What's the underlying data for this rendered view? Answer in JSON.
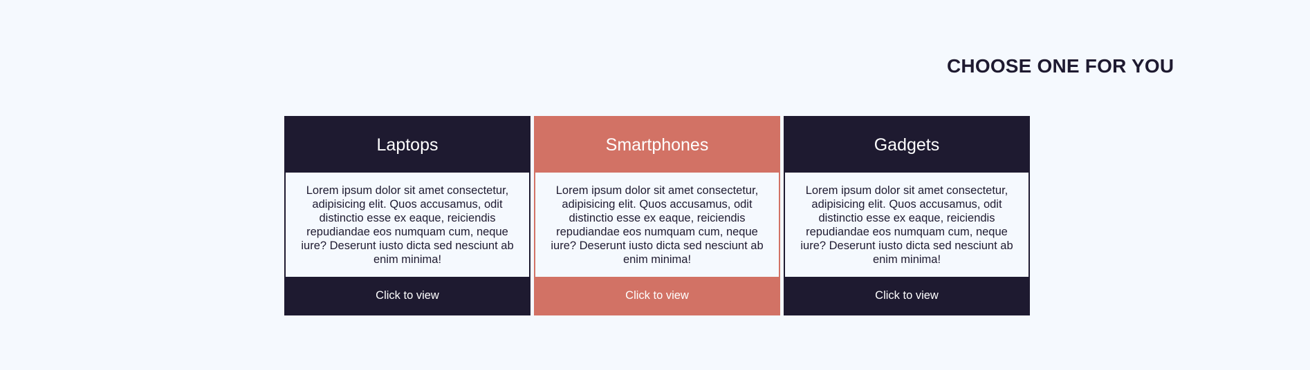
{
  "section": {
    "title": "CHOOSE ONE FOR YOU"
  },
  "colors": {
    "background": "#f5f9fe",
    "dark": "#1e1a30",
    "accent": "#d27265",
    "text_light": "#ffffff"
  },
  "cards": [
    {
      "title": "Laptops",
      "body": "Lorem ipsum dolor sit amet consectetur, adipisicing elit. Quos accusamus, odit distinctio esse ex eaque, reiciendis repudiandae eos numquam cum, neque iure? Deserunt iusto dicta sed nesciunt ab enim minima!",
      "cta": "Click to view"
    },
    {
      "title": "Smartphones",
      "body": "Lorem ipsum dolor sit amet consectetur, adipisicing elit. Quos accusamus, odit distinctio esse ex eaque, reiciendis repudiandae eos numquam cum, neque iure? Deserunt iusto dicta sed nesciunt ab enim minima!",
      "cta": "Click to view"
    },
    {
      "title": "Gadgets",
      "body": "Lorem ipsum dolor sit amet consectetur, adipisicing elit. Quos accusamus, odit distinctio esse ex eaque, reiciendis repudiandae eos numquam cum, neque iure? Deserunt iusto dicta sed nesciunt ab enim minima!",
      "cta": "Click to view"
    }
  ]
}
